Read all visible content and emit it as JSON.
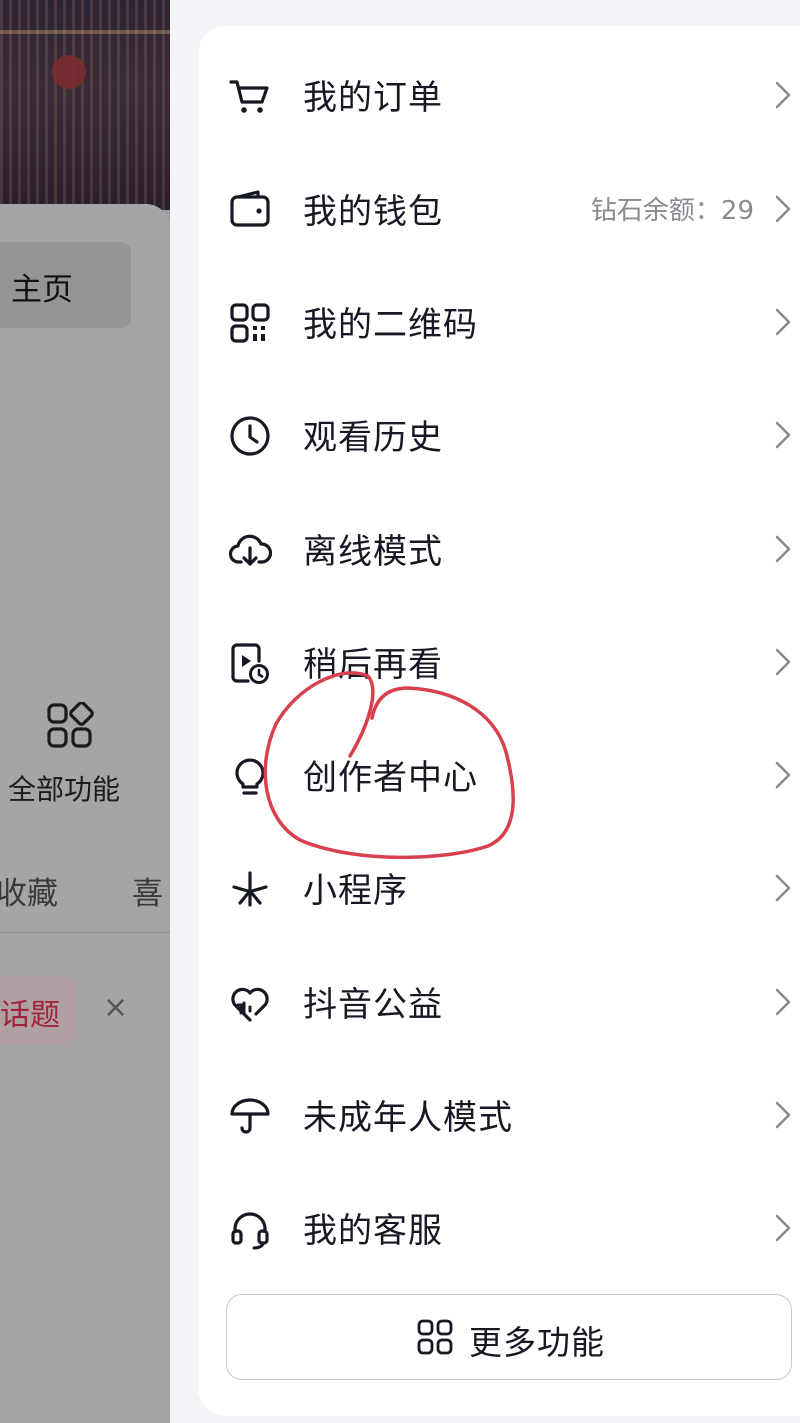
{
  "background_page": {
    "homepage_button_label": "主页",
    "all_features_label": "全部功能",
    "tab_favorites_partial": "收藏",
    "tab_likes_partial": "喜",
    "topic_chip_label": "话题",
    "close_symbol": "×"
  },
  "menu": {
    "items": [
      {
        "label": "我的订单",
        "icon": "cart-icon",
        "value": ""
      },
      {
        "label": "我的钱包",
        "icon": "wallet-icon",
        "value": "钻石余额：29"
      },
      {
        "label": "我的二维码",
        "icon": "qrcode-icon",
        "value": ""
      },
      {
        "label": "观看历史",
        "icon": "clock-icon",
        "value": ""
      },
      {
        "label": "离线模式",
        "icon": "cloud-download-icon",
        "value": ""
      },
      {
        "label": "稍后再看",
        "icon": "watch-later-icon",
        "value": ""
      },
      {
        "label": "创作者中心",
        "icon": "lightbulb-icon",
        "value": ""
      },
      {
        "label": "小程序",
        "icon": "mini-program-icon",
        "value": ""
      },
      {
        "label": "抖音公益",
        "icon": "heart-charity-icon",
        "value": ""
      },
      {
        "label": "未成年人模式",
        "icon": "umbrella-icon",
        "value": ""
      },
      {
        "label": "我的客服",
        "icon": "headset-icon",
        "value": ""
      }
    ],
    "more_button_label": "更多功能"
  },
  "annotation": {
    "color": "#d8404e",
    "circled_item": "创作者中心"
  }
}
